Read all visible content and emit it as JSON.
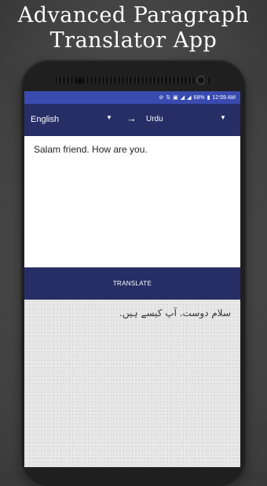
{
  "promo": {
    "title_line1": "Advanced Paragraph",
    "title_line2": "Translator App"
  },
  "status_bar": {
    "battery": "68%",
    "time": "12:59 AM"
  },
  "languages": {
    "from": "English",
    "to": "Urdu"
  },
  "input": {
    "text": "Salam friend. How are you."
  },
  "translate_button": {
    "label": "TRANSLATE"
  },
  "output": {
    "text": "سلام دوست. آپ کیسے ہیں."
  },
  "colors": {
    "status_bar": "#3a4bb0",
    "app_bar": "#272e66",
    "output_bg": "#e6e6e6"
  }
}
